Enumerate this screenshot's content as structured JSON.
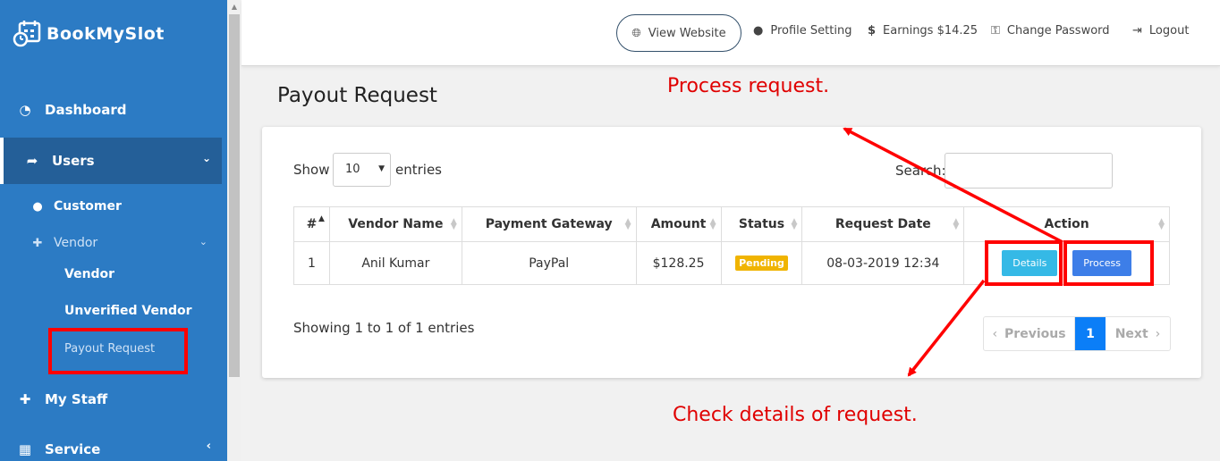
{
  "brand": {
    "name": "BookMySlot",
    "logo_icon": "calendar-clock-icon"
  },
  "sidebar": {
    "dashboard": "Dashboard",
    "users": "Users",
    "customer": "Customer",
    "vendor_group": "Vendor",
    "vendor": "Vendor",
    "unverified_vendor": "Unverified Vendor",
    "payout_request": "Payout Request",
    "my_staff": "My Staff",
    "service": "Service"
  },
  "topbar": {
    "view_website": "View Website",
    "profile_setting": "Profile Setting",
    "earnings": "Earnings $14.25",
    "change_password": "Change Password",
    "logout": "Logout"
  },
  "page": {
    "title": "Payout Request",
    "show_label": "Show",
    "show_value": "10",
    "entries_label": "entries",
    "search_label": "Search:",
    "showing_text": "Showing 1 to 1 of 1 entries"
  },
  "table": {
    "headers": [
      "#",
      "Vendor Name",
      "Payment Gateway",
      "Amount",
      "Status",
      "Request Date",
      "Action"
    ],
    "rows": [
      {
        "num": "1",
        "vendor": "Anil Kumar",
        "gateway": "PayPal",
        "amount": "$128.25",
        "status": "Pending",
        "date": "08-03-2019 12:34",
        "details_label": "Details",
        "process_label": "Process"
      }
    ]
  },
  "pagination": {
    "previous": "Previous",
    "current": "1",
    "next": "Next"
  },
  "annotations": {
    "process_note": "Process request.",
    "details_note": "Check details of request."
  },
  "colors": {
    "sidebar": "#2c7bc4",
    "sidebar_active": "#245f98",
    "annotation_red": "#ff0000",
    "badge_pending": "#f0b400",
    "btn_details": "#35b9e6",
    "btn_process": "#3d7ee8",
    "pager_active": "#0b7ef7"
  }
}
